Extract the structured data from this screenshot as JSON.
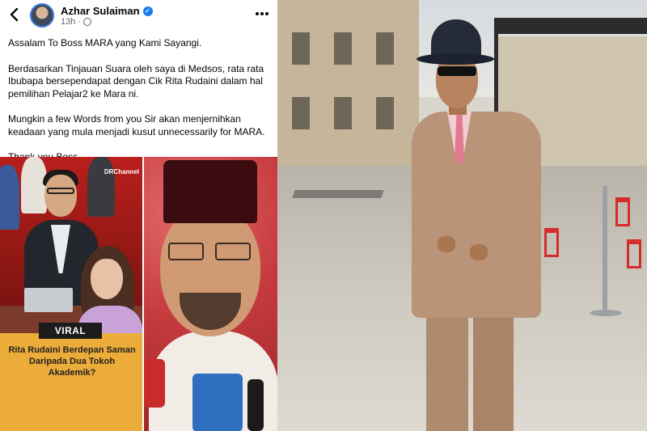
{
  "post": {
    "author": "Azhar Sulaiman",
    "time": "13h",
    "separator": "·",
    "paragraphs": [
      "Assalam To Boss MARA yang Kami Sayangi.",
      "Berdasarkan Tinjauan Suara oleh saya di Medsos, rata rata Ibubapa bersependapat dengan Cik Rita Rudaini dalam hal pemilihan Pelajar2 ke Mara ni.",
      "Mungkin a few Words from you Sir akan menjernihkan keadaan yang mula menjadi kusut unnecessarily for MARA.",
      "Thank you Boss."
    ]
  },
  "collage": {
    "channel_tag": "DRChannel",
    "badge": "VIRAL",
    "headline": "Rita Rudaini Berdepan Saman Daripada Dua Tokoh Akademik?"
  },
  "icons": {
    "back": "chevron-left-icon",
    "verified": "verified-badge-icon",
    "privacy": "globe-icon",
    "more": "more-horizontal-icon"
  },
  "colors": {
    "verified": "#1877f2",
    "headline_bg": "#ecac3a",
    "collage_red": "#c7261f"
  }
}
